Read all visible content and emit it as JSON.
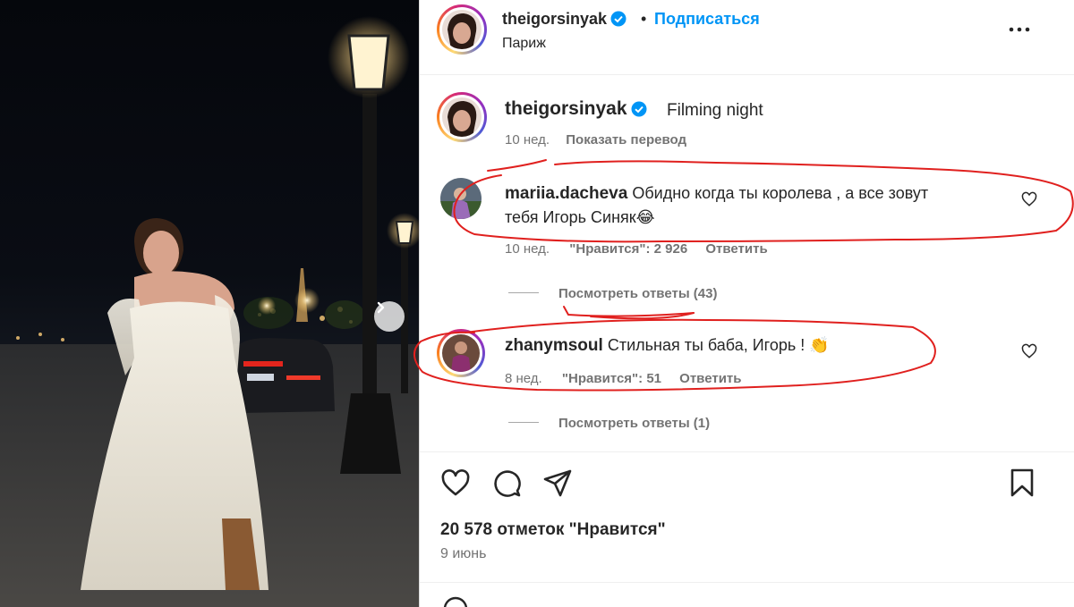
{
  "post": {
    "username": "theigorsinyak",
    "verified": true,
    "follow_label": "Подписаться",
    "separator": "•",
    "location": "Париж",
    "more_label": "..."
  },
  "caption": {
    "username": "theigorsinyak",
    "text": "Filming night",
    "age": "10 нед.",
    "translate_label": "Показать перевод"
  },
  "comments": [
    {
      "username": "mariia.dacheva",
      "text_line1": "Обидно когда ты королева , а все зовут",
      "text_line2": "тебя Игорь Синяк😂",
      "age": "10 нед.",
      "likes_label": "\"Нравится\": 2 926",
      "reply_label": "Ответить",
      "view_replies": "Посмотреть ответы (43)"
    },
    {
      "username": "zhanymsoul",
      "text_line1": "Стильная ты баба, Игорь ! 👏",
      "age": "8 нед.",
      "likes_label": "\"Нравится\": 51",
      "reply_label": "Ответить",
      "view_replies": "Посмотреть ответы (1)"
    }
  ],
  "actions": {
    "like_icon": "heart-icon",
    "comment_icon": "comment-icon",
    "share_icon": "share-icon",
    "save_icon": "bookmark-icon"
  },
  "likes_total": "20 578 отметок \"Нравится\"",
  "post_date": "9 июнь",
  "colors": {
    "accent": "#0095f6",
    "annotation_red": "#e0201e",
    "muted": "#737373"
  }
}
